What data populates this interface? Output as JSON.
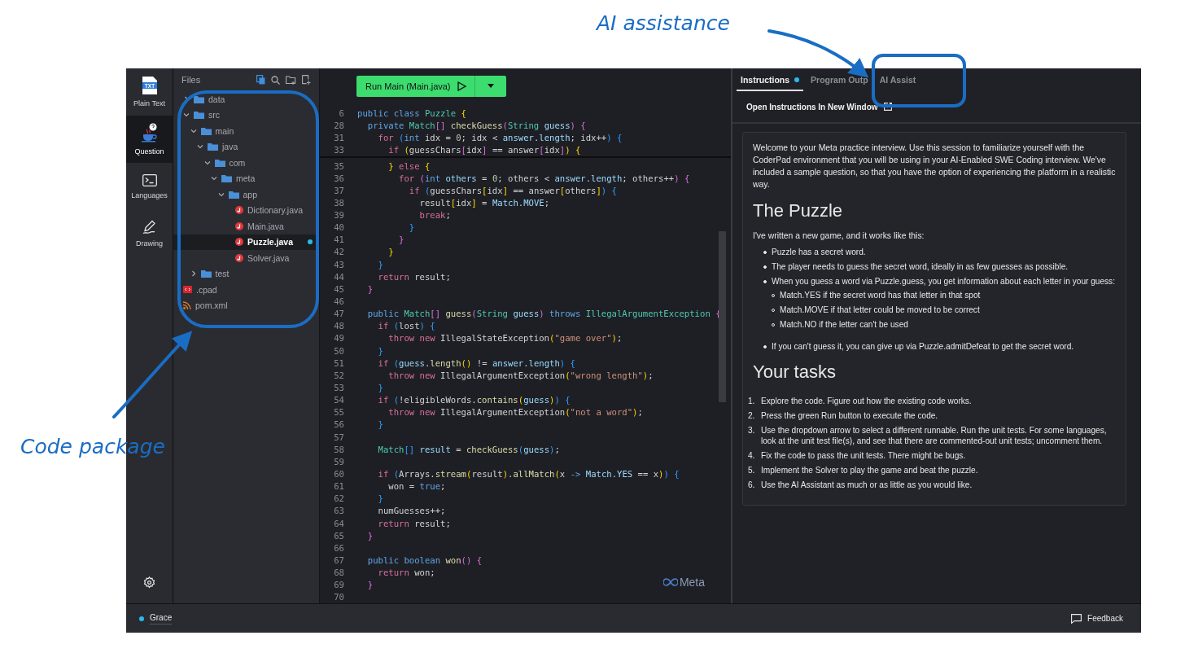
{
  "annotations": [
    {
      "text": "AI assistance"
    },
    {
      "text": "Code package"
    }
  ],
  "sidebar": {
    "items": [
      {
        "label": "Plain Text",
        "icon_text": "TXT",
        "selected": false
      },
      {
        "label": "Question",
        "selected": true
      },
      {
        "label": "Languages",
        "selected": false
      },
      {
        "label": "Drawing",
        "selected": false
      }
    ]
  },
  "files": {
    "title": "Files",
    "tree": [
      {
        "name": "data",
        "kind": "folder",
        "expanded": false,
        "selected": false
      },
      {
        "name": "src",
        "kind": "folder",
        "expanded": true,
        "selected": false,
        "children": [
          {
            "name": "main",
            "kind": "folder",
            "expanded": true,
            "selected": false,
            "children": [
              {
                "name": "java",
                "kind": "folder",
                "expanded": true,
                "selected": false,
                "children": [
                  {
                    "name": "com",
                    "kind": "folder",
                    "expanded": true,
                    "selected": false,
                    "children": [
                      {
                        "name": "meta",
                        "kind": "folder",
                        "expanded": true,
                        "selected": false,
                        "children": [
                          {
                            "name": "app",
                            "kind": "folder",
                            "expanded": true,
                            "selected": false,
                            "children": [
                              {
                                "name": "Dictionary.java",
                                "kind": "java",
                                "selected": false,
                                "modified": false
                              },
                              {
                                "name": "Main.java",
                                "kind": "java",
                                "selected": false,
                                "modified": false
                              },
                              {
                                "name": "Puzzle.java",
                                "kind": "java",
                                "selected": true,
                                "modified": true
                              },
                              {
                                "name": "Solver.java",
                                "kind": "java",
                                "selected": false,
                                "modified": false
                              }
                            ]
                          }
                        ]
                      }
                    ]
                  }
                ]
              }
            ]
          },
          {
            "name": "test",
            "kind": "folder",
            "expanded": false,
            "selected": false
          }
        ]
      },
      {
        "name": ".cpad",
        "kind": "cpad",
        "selected": false
      },
      {
        "name": "pom.xml",
        "kind": "xml",
        "selected": false
      }
    ]
  },
  "editor": {
    "run_button": "Run Main (Main.java)",
    "watermark": "Meta",
    "sticky_lines": [
      {
        "number": "6",
        "tokens": [
          {
            "kind": "decl",
            "text": "public class "
          },
          {
            "kind": "type",
            "text": "Puzzle "
          },
          {
            "kind": "b1",
            "text": "{"
          }
        ]
      },
      {
        "number": "28",
        "tokens": [
          {
            "kind": "decl",
            "text": "  private "
          },
          {
            "kind": "type",
            "text": "Match"
          },
          {
            "kind": "b2",
            "text": "[] "
          },
          {
            "kind": "fn",
            "text": "checkGuess"
          },
          {
            "kind": "b2",
            "text": "("
          },
          {
            "kind": "type",
            "text": "String "
          },
          {
            "kind": "var",
            "text": "guess"
          },
          {
            "kind": "b2",
            "text": ") {"
          }
        ]
      },
      {
        "number": "31",
        "tokens": [
          {
            "kind": "kw",
            "text": "    for "
          },
          {
            "kind": "b3",
            "text": "("
          },
          {
            "kind": "decl",
            "text": "int "
          },
          {
            "kind": "plain",
            "text": "idx = "
          },
          {
            "kind": "num",
            "text": "0"
          },
          {
            "kind": "plain",
            "text": "; idx < "
          },
          {
            "kind": "var",
            "text": "answer.length"
          },
          {
            "kind": "plain",
            "text": "; idx++"
          },
          {
            "kind": "b3",
            "text": ") {"
          }
        ]
      },
      {
        "number": "33",
        "tokens": [
          {
            "kind": "kw",
            "text": "      if "
          },
          {
            "kind": "b1",
            "text": "("
          },
          {
            "kind": "plain",
            "text": "guessChars"
          },
          {
            "kind": "b2",
            "text": "["
          },
          {
            "kind": "plain",
            "text": "idx"
          },
          {
            "kind": "b2",
            "text": "]"
          },
          {
            "kind": "plain",
            "text": " == answer"
          },
          {
            "kind": "b2",
            "text": "["
          },
          {
            "kind": "plain",
            "text": "idx"
          },
          {
            "kind": "b2",
            "text": "]"
          },
          {
            "kind": "b1",
            "text": ") {"
          }
        ]
      }
    ],
    "lines": [
      {
        "number": "35",
        "tokens": [
          {
            "kind": "b1",
            "text": "      } "
          },
          {
            "kind": "kw",
            "text": "else "
          },
          {
            "kind": "b1",
            "text": "{"
          }
        ]
      },
      {
        "number": "36",
        "tokens": [
          {
            "kind": "kw",
            "text": "        for "
          },
          {
            "kind": "b2",
            "text": "("
          },
          {
            "kind": "decl",
            "text": "int "
          },
          {
            "kind": "var",
            "text": "others"
          },
          {
            "kind": "plain",
            "text": " = "
          },
          {
            "kind": "num",
            "text": "0"
          },
          {
            "kind": "plain",
            "text": "; others < "
          },
          {
            "kind": "var",
            "text": "answer.length"
          },
          {
            "kind": "plain",
            "text": "; others++"
          },
          {
            "kind": "b2",
            "text": ") {"
          }
        ]
      },
      {
        "number": "37",
        "tokens": [
          {
            "kind": "kw",
            "text": "          if "
          },
          {
            "kind": "b3",
            "text": "("
          },
          {
            "kind": "plain",
            "text": "guessChars"
          },
          {
            "kind": "b1",
            "text": "["
          },
          {
            "kind": "plain",
            "text": "idx"
          },
          {
            "kind": "b1",
            "text": "]"
          },
          {
            "kind": "plain",
            "text": " == answer"
          },
          {
            "kind": "b1",
            "text": "["
          },
          {
            "kind": "plain",
            "text": "others"
          },
          {
            "kind": "b1",
            "text": "]"
          },
          {
            "kind": "b3",
            "text": ") {"
          }
        ]
      },
      {
        "number": "38",
        "tokens": [
          {
            "kind": "plain",
            "text": "            result"
          },
          {
            "kind": "b1",
            "text": "["
          },
          {
            "kind": "plain",
            "text": "idx"
          },
          {
            "kind": "b1",
            "text": "]"
          },
          {
            "kind": "plain",
            "text": " = "
          },
          {
            "kind": "var",
            "text": "Match.MOVE"
          },
          {
            "kind": "plain",
            "text": ";"
          }
        ]
      },
      {
        "number": "39",
        "tokens": [
          {
            "kind": "kw",
            "text": "            break"
          },
          {
            "kind": "plain",
            "text": ";"
          }
        ]
      },
      {
        "number": "40",
        "tokens": [
          {
            "kind": "b3",
            "text": "          }"
          }
        ]
      },
      {
        "number": "41",
        "tokens": [
          {
            "kind": "b2",
            "text": "        }"
          }
        ]
      },
      {
        "number": "42",
        "tokens": [
          {
            "kind": "b1",
            "text": "      }"
          }
        ]
      },
      {
        "number": "43",
        "tokens": [
          {
            "kind": "b3",
            "text": "    }"
          }
        ]
      },
      {
        "number": "44",
        "tokens": [
          {
            "kind": "kw",
            "text": "    return "
          },
          {
            "kind": "plain",
            "text": "result;"
          }
        ]
      },
      {
        "number": "45",
        "tokens": [
          {
            "kind": "b2",
            "text": "  }"
          }
        ]
      },
      {
        "number": "46"
      },
      {
        "number": "47",
        "tokens": [
          {
            "kind": "decl",
            "text": "  public "
          },
          {
            "kind": "type",
            "text": "Match"
          },
          {
            "kind": "b2",
            "text": "[] "
          },
          {
            "kind": "fn",
            "text": "guess"
          },
          {
            "kind": "b2",
            "text": "("
          },
          {
            "kind": "type",
            "text": "String "
          },
          {
            "kind": "var",
            "text": "guess"
          },
          {
            "kind": "b2",
            "text": ") "
          },
          {
            "kind": "decl",
            "text": "throws "
          },
          {
            "kind": "type",
            "text": "IllegalArgumentException "
          },
          {
            "kind": "b2",
            "text": "{"
          }
        ]
      },
      {
        "number": "48",
        "tokens": [
          {
            "kind": "kw",
            "text": "    if "
          },
          {
            "kind": "b3",
            "text": "("
          },
          {
            "kind": "plain",
            "text": "lost"
          },
          {
            "kind": "b3",
            "text": ") {"
          }
        ]
      },
      {
        "number": "49",
        "tokens": [
          {
            "kind": "kw",
            "text": "      throw new "
          },
          {
            "kind": "plain",
            "text": "IllegalStateException"
          },
          {
            "kind": "b1",
            "text": "("
          },
          {
            "kind": "str",
            "text": "\"game over\""
          },
          {
            "kind": "b1",
            "text": ")"
          },
          {
            "kind": "plain",
            "text": ";"
          }
        ]
      },
      {
        "number": "50",
        "tokens": [
          {
            "kind": "b3",
            "text": "    }"
          }
        ]
      },
      {
        "number": "51",
        "tokens": [
          {
            "kind": "kw",
            "text": "    if "
          },
          {
            "kind": "b3",
            "text": "("
          },
          {
            "kind": "var",
            "text": "guess"
          },
          {
            "kind": "plain",
            "text": "."
          },
          {
            "kind": "fn",
            "text": "length"
          },
          {
            "kind": "b1",
            "text": "()"
          },
          {
            "kind": "plain",
            "text": " != "
          },
          {
            "kind": "var",
            "text": "answer.length"
          },
          {
            "kind": "b3",
            "text": ") {"
          }
        ]
      },
      {
        "number": "52",
        "tokens": [
          {
            "kind": "kw",
            "text": "      throw new "
          },
          {
            "kind": "plain",
            "text": "IllegalArgumentException"
          },
          {
            "kind": "b1",
            "text": "("
          },
          {
            "kind": "str",
            "text": "\"wrong length\""
          },
          {
            "kind": "b1",
            "text": ")"
          },
          {
            "kind": "plain",
            "text": ";"
          }
        ]
      },
      {
        "number": "53",
        "tokens": [
          {
            "kind": "b3",
            "text": "    }"
          }
        ]
      },
      {
        "number": "54",
        "tokens": [
          {
            "kind": "kw",
            "text": "    if "
          },
          {
            "kind": "b3",
            "text": "("
          },
          {
            "kind": "plain",
            "text": "!eligibleWords."
          },
          {
            "kind": "fn",
            "text": "contains"
          },
          {
            "kind": "b1",
            "text": "("
          },
          {
            "kind": "var",
            "text": "guess"
          },
          {
            "kind": "b1",
            "text": ")"
          },
          {
            "kind": "b3",
            "text": ") {"
          }
        ]
      },
      {
        "number": "55",
        "tokens": [
          {
            "kind": "kw",
            "text": "      throw new "
          },
          {
            "kind": "plain",
            "text": "IllegalArgumentException"
          },
          {
            "kind": "b1",
            "text": "("
          },
          {
            "kind": "str",
            "text": "\"not a word\""
          },
          {
            "kind": "b1",
            "text": ")"
          },
          {
            "kind": "plain",
            "text": ";"
          }
        ]
      },
      {
        "number": "56",
        "tokens": [
          {
            "kind": "b3",
            "text": "    }"
          }
        ]
      },
      {
        "number": "57"
      },
      {
        "number": "58",
        "tokens": [
          {
            "kind": "type",
            "text": "    Match"
          },
          {
            "kind": "b3",
            "text": "[]"
          },
          {
            "kind": "var",
            "text": " result"
          },
          {
            "kind": "plain",
            "text": " = "
          },
          {
            "kind": "fn",
            "text": "checkGuess"
          },
          {
            "kind": "b3",
            "text": "("
          },
          {
            "kind": "var",
            "text": "guess"
          },
          {
            "kind": "b3",
            "text": ")"
          },
          {
            "kind": "plain",
            "text": ";"
          }
        ]
      },
      {
        "number": "59"
      },
      {
        "number": "60",
        "tokens": [
          {
            "kind": "kw",
            "text": "    if "
          },
          {
            "kind": "b3",
            "text": "("
          },
          {
            "kind": "plain",
            "text": "Arrays."
          },
          {
            "kind": "fn",
            "text": "stream"
          },
          {
            "kind": "b1",
            "text": "("
          },
          {
            "kind": "plain",
            "text": "result"
          },
          {
            "kind": "b1",
            "text": ")"
          },
          {
            "kind": "plain",
            "text": "."
          },
          {
            "kind": "fn",
            "text": "allMatch"
          },
          {
            "kind": "b1",
            "text": "("
          },
          {
            "kind": "plain",
            "text": "x "
          },
          {
            "kind": "decl",
            "text": "-> "
          },
          {
            "kind": "var",
            "text": "Match.YES"
          },
          {
            "kind": "plain",
            "text": " == x"
          },
          {
            "kind": "b1",
            "text": ")"
          },
          {
            "kind": "b3",
            "text": ") {"
          }
        ]
      },
      {
        "number": "61",
        "tokens": [
          {
            "kind": "plain",
            "text": "      won = "
          },
          {
            "kind": "decl",
            "text": "true"
          },
          {
            "kind": "plain",
            "text": ";"
          }
        ]
      },
      {
        "number": "62",
        "tokens": [
          {
            "kind": "b3",
            "text": "    }"
          }
        ]
      },
      {
        "number": "63",
        "tokens": [
          {
            "kind": "plain",
            "text": "    numGuesses++;"
          }
        ]
      },
      {
        "number": "64",
        "tokens": [
          {
            "kind": "kw",
            "text": "    return "
          },
          {
            "kind": "plain",
            "text": "result;"
          }
        ]
      },
      {
        "number": "65",
        "tokens": [
          {
            "kind": "b2",
            "text": "  }"
          }
        ]
      },
      {
        "number": "66"
      },
      {
        "number": "67",
        "tokens": [
          {
            "kind": "decl",
            "text": "  public boolean "
          },
          {
            "kind": "fn",
            "text": "won"
          },
          {
            "kind": "b2",
            "text": "() {"
          }
        ]
      },
      {
        "number": "68",
        "tokens": [
          {
            "kind": "kw",
            "text": "    return "
          },
          {
            "kind": "plain",
            "text": "won;"
          }
        ]
      },
      {
        "number": "69",
        "tokens": [
          {
            "kind": "b2",
            "text": "  }"
          }
        ]
      },
      {
        "number": "70"
      }
    ]
  },
  "panel": {
    "tabs": [
      {
        "label": "Instructions",
        "selected": true,
        "dot": true
      },
      {
        "label": "Program Outp",
        "selected": false,
        "dot": false
      },
      {
        "label": "AI Assist",
        "selected": false,
        "dot": false
      }
    ],
    "open_link": "Open Instructions In New Window",
    "blocks": [
      {
        "kind": "paragraph",
        "text": "Welcome to your Meta practice interview. Use this session to familiarize yourself with the CoderPad environment that you will be using in your AI-Enabled SWE Coding interview. We've included a sample question, so that you have the option of experiencing the platform in a realistic way."
      },
      {
        "kind": "heading",
        "text": "The Puzzle"
      },
      {
        "kind": "paragraph",
        "text": "I've written a new game, and it works like this:"
      },
      {
        "kind": "bullets",
        "items": [
          {
            "text": "Puzzle has a secret word."
          },
          {
            "text": "The player needs to guess the secret word, ideally in as few guesses as possible."
          },
          {
            "text": "When you guess a word via Puzzle.guess, you get information about each letter in your guess:",
            "children": [
              {
                "text": "Match.YES if the secret word has that letter in that spot"
              },
              {
                "text": "Match.MOVE if that letter could be moved to be correct"
              },
              {
                "text": "Match.NO if the letter can't be used"
              }
            ]
          },
          {
            "text": "If you can't guess it, you can give up via Puzzle.admitDefeat to get the secret word."
          }
        ]
      },
      {
        "kind": "heading",
        "text": "Your tasks"
      },
      {
        "kind": "numbered",
        "items": [
          {
            "number": "1.",
            "text": "Explore the code. Figure out how the existing code works."
          },
          {
            "number": "2.",
            "text": "Press the green Run button to execute the code."
          },
          {
            "number": "3.",
            "text": "Use the dropdown arrow to select a different runnable. Run the unit tests. For some languages, look at the unit test file(s), and see that there are commented-out unit tests; uncomment them."
          },
          {
            "number": "4.",
            "text": "Fix the code to pass the unit tests. There might be bugs."
          },
          {
            "number": "5.",
            "text": "Implement the Solver to play the game and beat the puzzle."
          },
          {
            "number": "6.",
            "text": "Use the AI Assistant as much or as little as you would like."
          }
        ]
      }
    ]
  },
  "status_bar": {
    "user": "Grace",
    "feedback": "Feedback"
  }
}
